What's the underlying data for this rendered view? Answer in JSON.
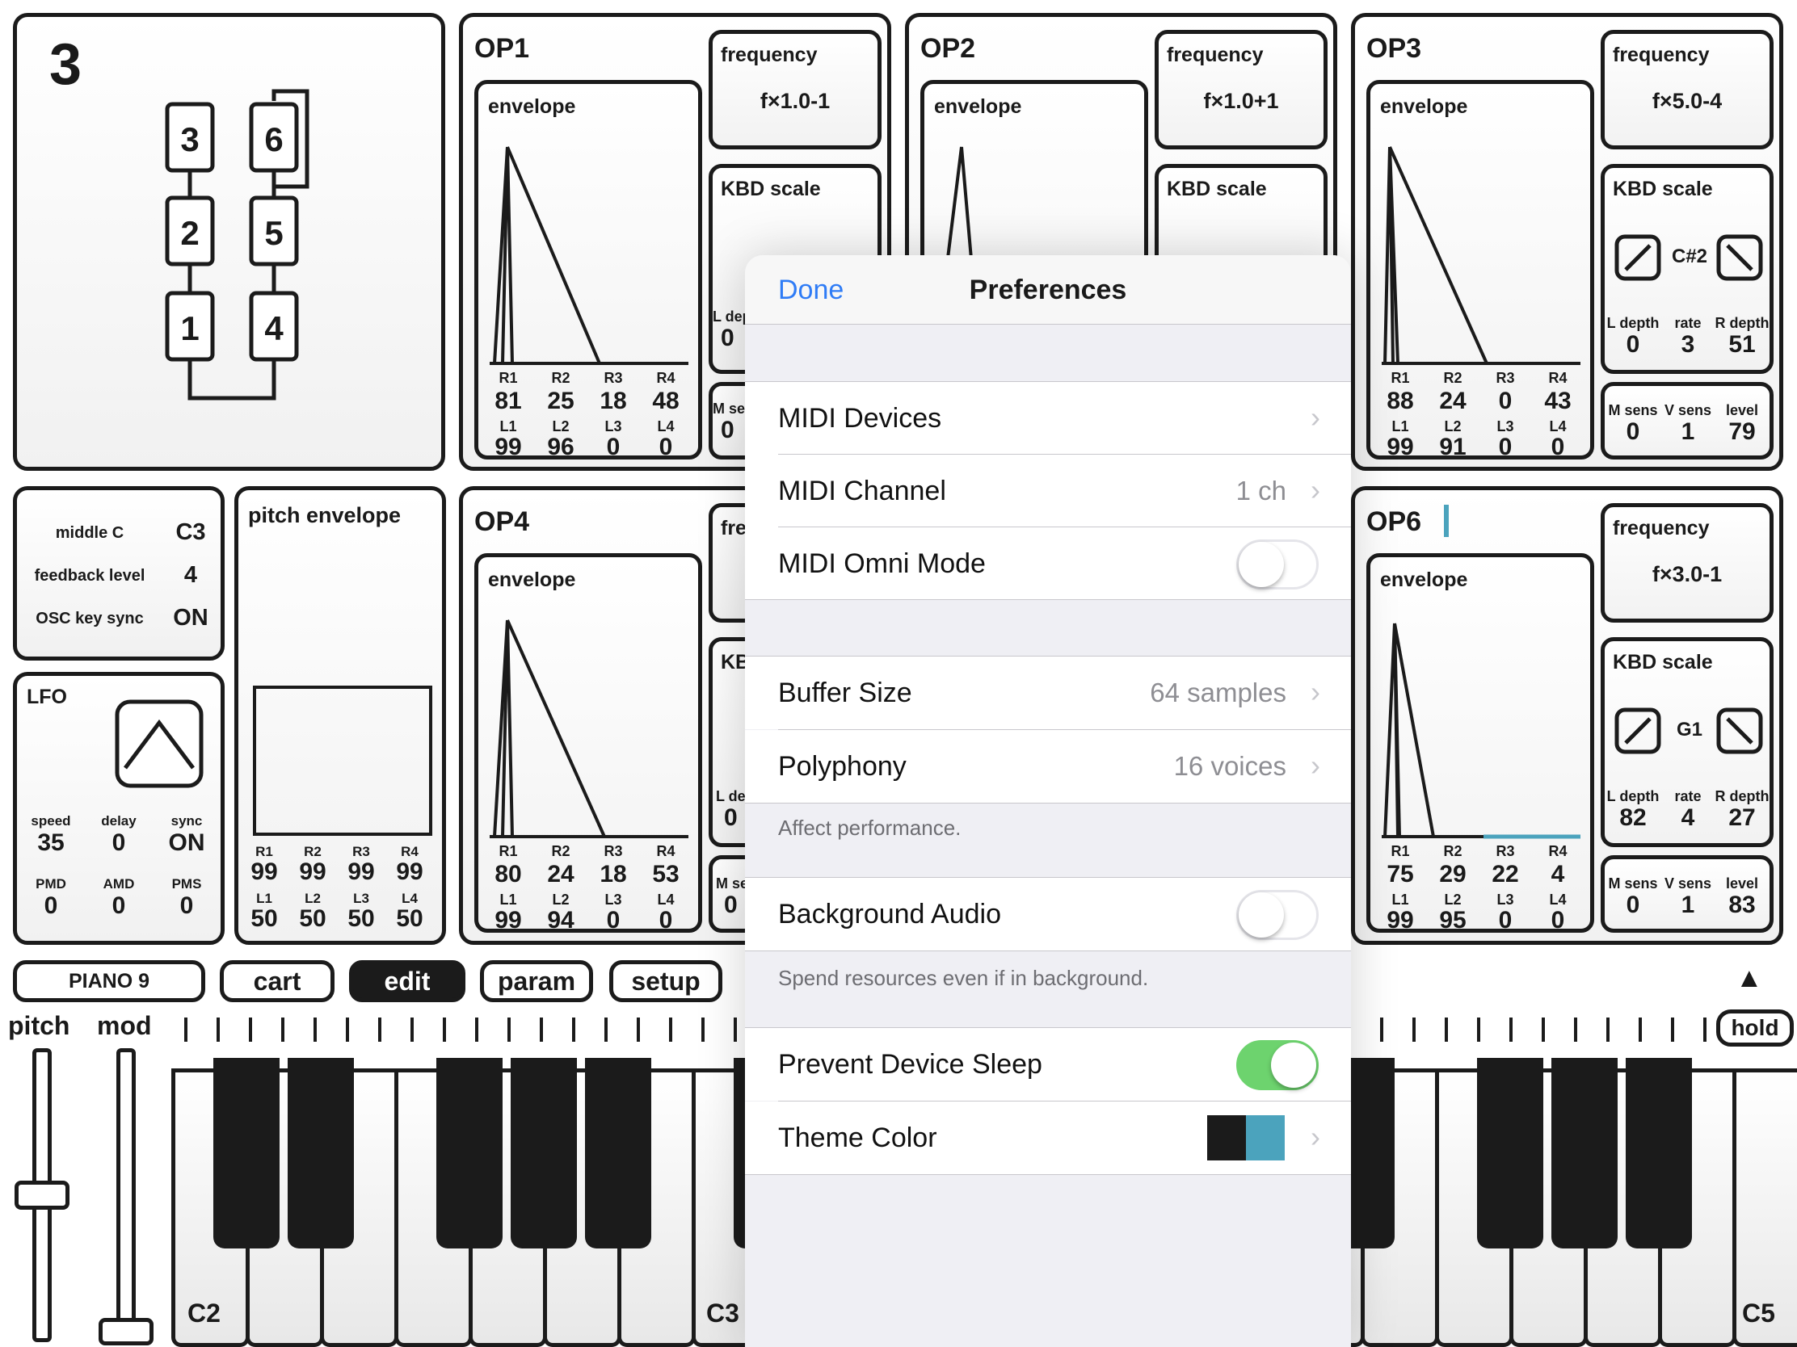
{
  "algorithm": {
    "number": "3",
    "boxes": [
      "3",
      "2",
      "1",
      "6",
      "5",
      "4"
    ]
  },
  "ops": [
    {
      "name": "OP1",
      "frequency_label": "frequency",
      "frequency": "f×1.0-1",
      "envelope_label": "envelope",
      "kbd_label": "KBD scale",
      "r_labels": [
        "R1",
        "R2",
        "R3",
        "R4"
      ],
      "r": [
        "81",
        "25",
        "18",
        "48"
      ],
      "l_labels": [
        "L1",
        "L2",
        "L3",
        "L4"
      ],
      "l": [
        "99",
        "96",
        "0",
        "0"
      ]
    },
    {
      "name": "OP2",
      "frequency_label": "frequency",
      "frequency": "f×1.0+1",
      "envelope_label": "envelope",
      "kbd_label": "KBD scale"
    },
    {
      "name": "OP3",
      "frequency_label": "frequency",
      "frequency": "f×5.0-4",
      "envelope_label": "envelope",
      "kbd_label": "KBD scale",
      "kbd_note": "C#2",
      "kbd_params": {
        "labels": [
          "L depth",
          "rate",
          "R depth"
        ],
        "values": [
          "0",
          "3",
          "51"
        ]
      },
      "out_params": {
        "labels": [
          "M sens",
          "V sens",
          "level"
        ],
        "values": [
          "0",
          "1",
          "79"
        ]
      },
      "r_labels": [
        "R1",
        "R2",
        "R3",
        "R4"
      ],
      "r": [
        "88",
        "24",
        "0",
        "43"
      ],
      "l_labels": [
        "L1",
        "L2",
        "L3",
        "L4"
      ],
      "l": [
        "99",
        "91",
        "0",
        "0"
      ]
    },
    {
      "name": "OP4",
      "envelope_label": "envelope",
      "frequency_label": "fre",
      "kbd_label": "KB",
      "r_labels": [
        "R1",
        "R2",
        "R3",
        "R4"
      ],
      "r": [
        "80",
        "24",
        "18",
        "53"
      ],
      "l_labels": [
        "L1",
        "L2",
        "L3",
        "L4"
      ],
      "l": [
        "99",
        "94",
        "0",
        "0"
      ]
    },
    {
      "name": "OP6",
      "frequency_label": "frequency",
      "frequency": "f×3.0-1",
      "envelope_label": "envelope",
      "kbd_label": "KBD scale",
      "kbd_note": "G1",
      "kbd_params": {
        "labels": [
          "L depth",
          "rate",
          "R depth"
        ],
        "values": [
          "82",
          "4",
          "27"
        ]
      },
      "out_params": {
        "labels": [
          "M sens",
          "V sens",
          "level"
        ],
        "values": [
          "0",
          "1",
          "83"
        ]
      },
      "r_labels": [
        "R1",
        "R2",
        "R3",
        "R4"
      ],
      "r": [
        "75",
        "29",
        "22",
        "4"
      ],
      "l_labels": [
        "L1",
        "L2",
        "L3",
        "L4"
      ],
      "l": [
        "99",
        "95",
        "0",
        "0"
      ]
    }
  ],
  "clipped": {
    "l_dep": "L dep",
    "m_se": "M se",
    "zero": "0"
  },
  "globals": {
    "middle_c_label": "middle C",
    "middle_c": "C3",
    "feedback_label": "feedback level",
    "feedback": "4",
    "osc_sync_label": "OSC key sync",
    "osc_sync": "ON"
  },
  "pitch_env": {
    "title": "pitch envelope",
    "r_labels": [
      "R1",
      "R2",
      "R3",
      "R4"
    ],
    "r": [
      "99",
      "99",
      "99",
      "99"
    ],
    "l_labels": [
      "L1",
      "L2",
      "L3",
      "L4"
    ],
    "l": [
      "50",
      "50",
      "50",
      "50"
    ]
  },
  "lfo": {
    "title": "LFO",
    "row1_labels": [
      "speed",
      "delay",
      "sync"
    ],
    "row1": [
      "35",
      "0",
      "ON"
    ],
    "row2_labels": [
      "PMD",
      "AMD",
      "PMS"
    ],
    "row2": [
      "0",
      "0",
      "0"
    ]
  },
  "toolbar": {
    "preset": "PIANO 9",
    "cart": "cart",
    "edit": "edit",
    "param": "param",
    "setup": "setup"
  },
  "keyboard": {
    "pitch": "pitch",
    "mod": "mod",
    "hold": "hold",
    "c2": "C2",
    "c3": "C3",
    "c5": "C5",
    "up_arrow": "▲"
  },
  "prefs": {
    "done": "Done",
    "title": "Preferences",
    "midi_devices": "MIDI Devices",
    "midi_channel": "MIDI Channel",
    "midi_channel_value": "1 ch",
    "midi_omni": "MIDI Omni Mode",
    "midi_omni_on": false,
    "buffer_size": "Buffer Size",
    "buffer_size_value": "64 samples",
    "polyphony": "Polyphony",
    "polyphony_value": "16 voices",
    "perf_footer": "Affect performance.",
    "bg_audio": "Background Audio",
    "bg_audio_on": false,
    "bg_footer": "Spend resources even if in background.",
    "prevent_sleep": "Prevent Device Sleep",
    "prevent_sleep_on": true,
    "theme": "Theme Color",
    "theme_colors": [
      "#1b1b1b",
      "#4ba3bd"
    ]
  },
  "colors": {
    "accent": "#4ba3bd",
    "ios_blue": "#2f7cf6",
    "toggle_on": "#6dd36e"
  }
}
